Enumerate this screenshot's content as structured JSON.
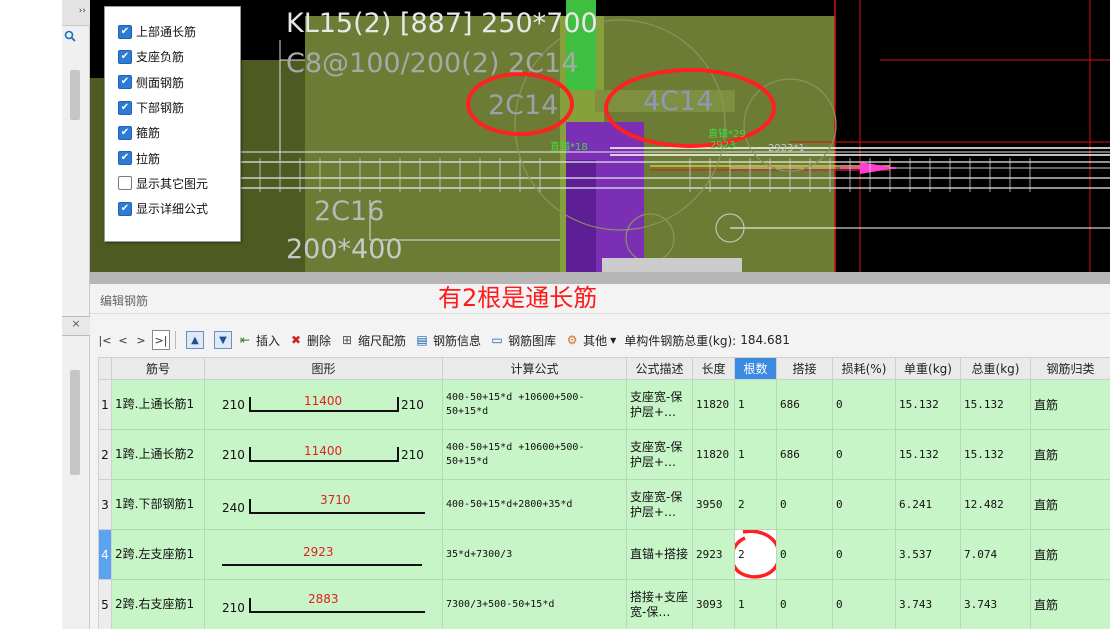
{
  "left_panel": {
    "collapse_icon": "››",
    "close_icon": "×"
  },
  "cad": {
    "title_line1": "KL15(2) [887] 250*700",
    "title_line2": "C8@100/200(2) 2C14",
    "label_2c14": "2C14",
    "label_4c14": "4C14",
    "label_2c16": "2C16",
    "label_size": "200*400",
    "small_green1": "直锚*18",
    "small_green2": "2923",
    "small_green3": "直锚*29",
    "small_grey": "2923*1"
  },
  "checkboxes": [
    {
      "label": "上部通长筋",
      "checked": true
    },
    {
      "label": "支座负筋",
      "checked": true
    },
    {
      "label": "侧面钢筋",
      "checked": true
    },
    {
      "label": "下部钢筋",
      "checked": true
    },
    {
      "label": "箍筋",
      "checked": true
    },
    {
      "label": "拉筋",
      "checked": true
    },
    {
      "label": "显示其它图元",
      "checked": false
    },
    {
      "label": "显示详细公式",
      "checked": true
    }
  ],
  "editor": {
    "title": "编辑钢筋",
    "annotation": "有2根是通长筋"
  },
  "toolbar": {
    "nav": [
      "|<",
      "<",
      ">",
      ">|"
    ],
    "insert": "插入",
    "delete": "删除",
    "scale": "缩尺配筋",
    "info": "钢筋信息",
    "library": "钢筋图库",
    "other": "其他",
    "total_label": "单构件钢筋总重(kg):",
    "total_value": "184.681"
  },
  "table": {
    "headers": [
      "",
      "筋号",
      "图形",
      "计算公式",
      "公式描述",
      "长度",
      "根数",
      "搭接",
      "损耗(%)",
      "单重(kg)",
      "总重(kg)",
      "钢筋归类"
    ],
    "rows": [
      {
        "num": "1",
        "name": "1跨.上通长筋1",
        "shape_left": "210",
        "shape_mid": "11400",
        "shape_right": "210",
        "formula": "400-50+15*d +10600+500-50+15*d",
        "desc": "支座宽-保护层+…",
        "length": "11820",
        "count": "1",
        "lap": "686",
        "loss": "0",
        "unit": "15.132",
        "total": "15.132",
        "category": "直筋"
      },
      {
        "num": "2",
        "name": "1跨.上通长筋2",
        "shape_left": "210",
        "shape_mid": "11400",
        "shape_right": "210",
        "formula": "400-50+15*d +10600+500-50+15*d",
        "desc": "支座宽-保护层+…",
        "length": "11820",
        "count": "1",
        "lap": "686",
        "loss": "0",
        "unit": "15.132",
        "total": "15.132",
        "category": "直筋"
      },
      {
        "num": "3",
        "name": "1跨.下部钢筋1",
        "shape_left": "240",
        "shape_mid": "3710",
        "shape_right": "",
        "formula": "400-50+15*d+2800+35*d",
        "desc": "支座宽-保护层+…",
        "length": "3950",
        "count": "2",
        "lap": "0",
        "loss": "0",
        "unit": "6.241",
        "total": "12.482",
        "category": "直筋"
      },
      {
        "num": "4",
        "name": "2跨.左支座筋1",
        "shape_left": "",
        "shape_mid": "2923",
        "shape_right": "",
        "formula": "35*d+7300/3",
        "desc": "直锚+搭接",
        "length": "2923",
        "count": "2",
        "lap": "0",
        "loss": "0",
        "unit": "3.537",
        "total": "7.074",
        "category": "直筋"
      },
      {
        "num": "5",
        "name": "2跨.右支座筋1",
        "shape_left": "210",
        "shape_mid": "2883",
        "shape_right": "",
        "formula": "7300/3+500-50+15*d",
        "desc": "搭接+支座宽-保…",
        "length": "3093",
        "count": "1",
        "lap": "0",
        "loss": "0",
        "unit": "3.743",
        "total": "3.743",
        "category": "直筋"
      }
    ]
  }
}
